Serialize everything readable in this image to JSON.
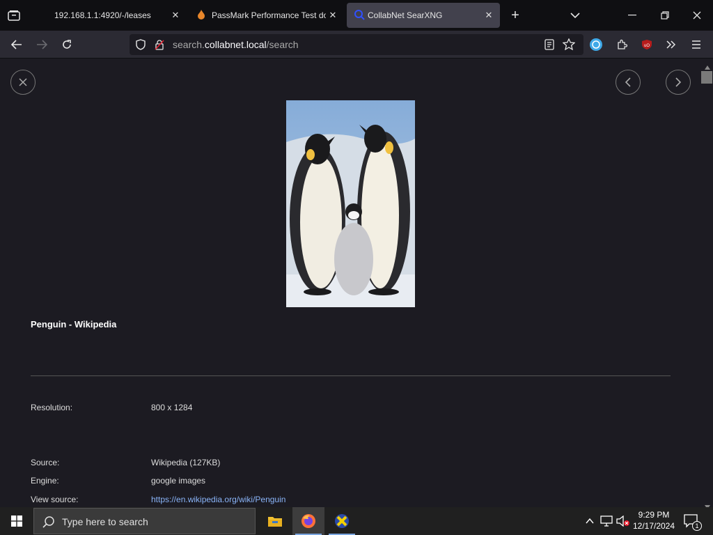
{
  "browser": {
    "tabs": [
      {
        "title": "192.168.1.1:4920/-/leases",
        "active": false
      },
      {
        "title": "PassMark Performance Test do",
        "active": false
      },
      {
        "title": "CollabNet SearXNG",
        "active": true
      }
    ],
    "url": {
      "host_prefix": "search.",
      "host": "collabnet.local",
      "path": "/search"
    }
  },
  "detail": {
    "title": "Penguin - Wikipedia",
    "fields": [
      {
        "label": "Resolution:",
        "value": "800 x 1284"
      },
      {
        "label": "Source:",
        "value": "Wikipedia (127KB)"
      },
      {
        "label": "Engine:",
        "value": "google images"
      },
      {
        "label": "View source:",
        "value": "https://en.wikipedia.org/wiki/Penguin"
      }
    ]
  },
  "taskbar": {
    "search_placeholder": "Type here to search",
    "time": "9:29 PM",
    "date": "12/17/2024",
    "notification_count": "1"
  },
  "colors": {
    "link": "#8ab4f8",
    "active_tab": "#42414d",
    "page_bg": "#1c1b22"
  }
}
